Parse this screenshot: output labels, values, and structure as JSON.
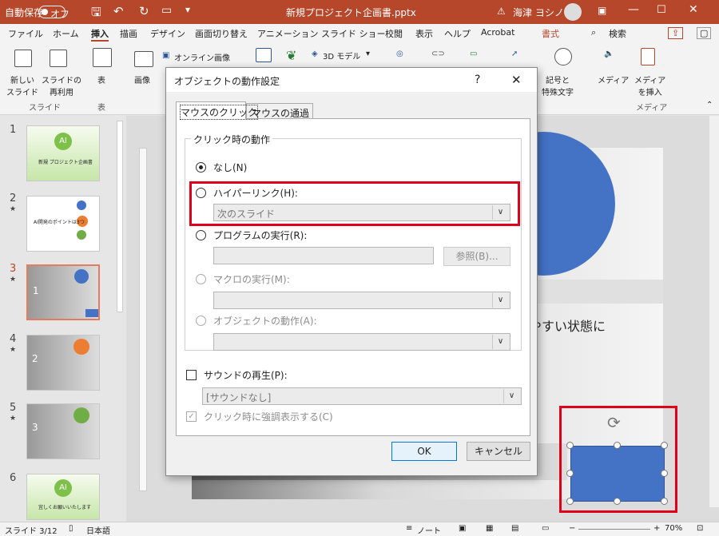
{
  "titlebar": {
    "autosave_label": "自動保存",
    "autosave_state": "オフ",
    "filename": "新規プロジェクト企画書.pptx",
    "user": "海津 ヨシノリ"
  },
  "tabs": [
    "ファイル",
    "ホーム",
    "挿入",
    "描画",
    "デザイン",
    "画面切り替え",
    "アニメーション",
    "スライド ショー",
    "校閲",
    "表示",
    "ヘルプ",
    "Acrobat",
    "書式",
    "検索"
  ],
  "ribbon": {
    "new_slide": "新しい\nスライド",
    "reuse_slide": "スライドの\n再利用",
    "group_slide": "スライド",
    "table": "表",
    "group_table": "表",
    "image": "画像",
    "online_image": "オンライン画像",
    "model_3d": "3D モデル",
    "symbol": "記号と\n特殊文字",
    "media": "メディア",
    "media_insert": "メディア\nを挿入",
    "group_media": "メディア"
  },
  "thumbs": [
    {
      "num": "1",
      "star": "",
      "title": "新規 プロジェクト企画書",
      "ai": "AI"
    },
    {
      "num": "2",
      "star": "★",
      "title": "AI開発のポイントは3つ"
    },
    {
      "num": "3",
      "star": "★",
      "title": "1"
    },
    {
      "num": "4",
      "star": "★",
      "title": "2"
    },
    {
      "num": "5",
      "star": "★",
      "title": "3"
    },
    {
      "num": "6",
      "star": "",
      "title": "宜しくお願いいたします",
      "ai": "AI"
    }
  ],
  "stage": {
    "slide_text": "やすい状態に"
  },
  "dialog": {
    "title": "オブジェクトの動作設定",
    "help": "?",
    "close": "✕",
    "tab_click": "マウスのクリック",
    "tab_over": "マウスの通過",
    "group_label": "クリック時の動作",
    "opt_none": "なし(N)",
    "opt_hyperlink": "ハイパーリンク(H):",
    "hyperlink_value": "次のスライド",
    "opt_program": "プログラムの実行(R):",
    "browse": "参照(B)...",
    "opt_macro": "マクロの実行(M):",
    "opt_action": "オブジェクトの動作(A):",
    "sound": "サウンドの再生(P):",
    "sound_value": "[サウンドなし]",
    "highlight": "クリック時に強調表示する(C)",
    "ok": "OK",
    "cancel": "キャンセル"
  },
  "status": {
    "slide": "スライド 3/12",
    "lang": "日本語",
    "notes": "ノート",
    "zoom": "70%"
  },
  "colors": {
    "accent": "#b7472a",
    "shape": "#4472c4",
    "highlight_box": "#e0001a"
  }
}
